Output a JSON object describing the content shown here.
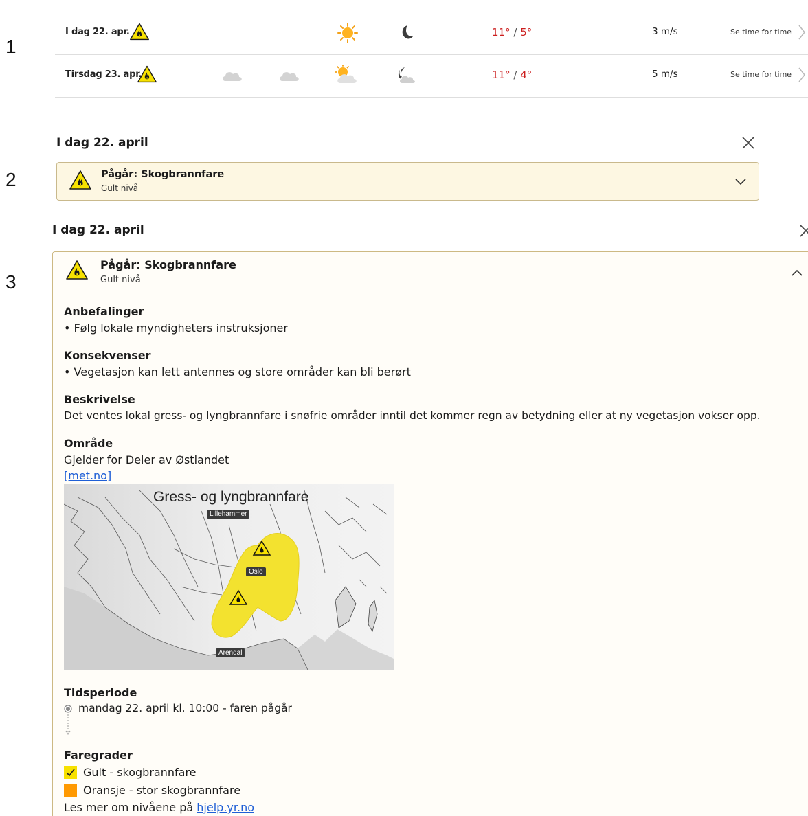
{
  "markers": [
    "1",
    "2",
    "3"
  ],
  "forecast": {
    "rows": [
      {
        "date": "I dag 22. apr.",
        "symbols": [
          "sun-icon",
          "moon-icon"
        ],
        "temp_high": "11°",
        "temp_low": "5°",
        "wind": "3 m/s",
        "link": "Se time for time"
      },
      {
        "date": "Tirsdag 23. apr.",
        "symbols": [
          "cloud-icon",
          "cloud-icon",
          "partly-sunny-icon",
          "moon-cloud-icon"
        ],
        "temp_high": "11°",
        "temp_low": "4°",
        "wind": "5 m/s",
        "link": "Se time for time"
      }
    ],
    "temp_separator": "/"
  },
  "warning_collapsed": {
    "day_title": "I dag 22. april",
    "title": "Pågår: Skogbrannfare",
    "level": "Gult nivå"
  },
  "warning_expanded": {
    "day_title": "I dag 22. april",
    "title": "Pågår: Skogbrannfare",
    "level": "Gult nivå",
    "recommendations_heading": "Anbefalinger",
    "recommendations": "• Følg lokale myndigheters instruksjoner",
    "consequences_heading": "Konsekvenser",
    "consequences": "• Vegetasjon kan lett antennes og store områder kan bli berørt",
    "description_heading": "Beskrivelse",
    "description": "Det ventes lokal gress- og lyngbrannfare i snøfrie områder inntil det kommer regn av betydning eller at ny vegetasjon vokser opp.",
    "area_heading": "Område",
    "area": "Gjelder for Deler av Østlandet",
    "source_link": "[met.no]",
    "map": {
      "title": "Gress- og lyngbrannfare",
      "labels": [
        "Lillehammer",
        "Oslo",
        "Arendal"
      ]
    },
    "period_heading": "Tidsperiode",
    "period": "mandag 22. april kl. 10:00 - faren pågår",
    "levels_heading": "Faregrader",
    "levels": [
      {
        "label": "Gult - skogbrannfare",
        "color": "#f7e100",
        "checked": true
      },
      {
        "label": "Oransje - stor skogbrannfare",
        "color": "#ff9900",
        "checked": false
      }
    ],
    "more_text": "Les mer om nivåene på",
    "more_link": "hjelp.yr.no"
  },
  "colors": {
    "warning_yellow": "#f7e100",
    "temp_red": "#cc1f1f",
    "link_blue": "#1f5fd6",
    "card_border": "#c9b98c",
    "card_bg": "#fdf7e2"
  }
}
